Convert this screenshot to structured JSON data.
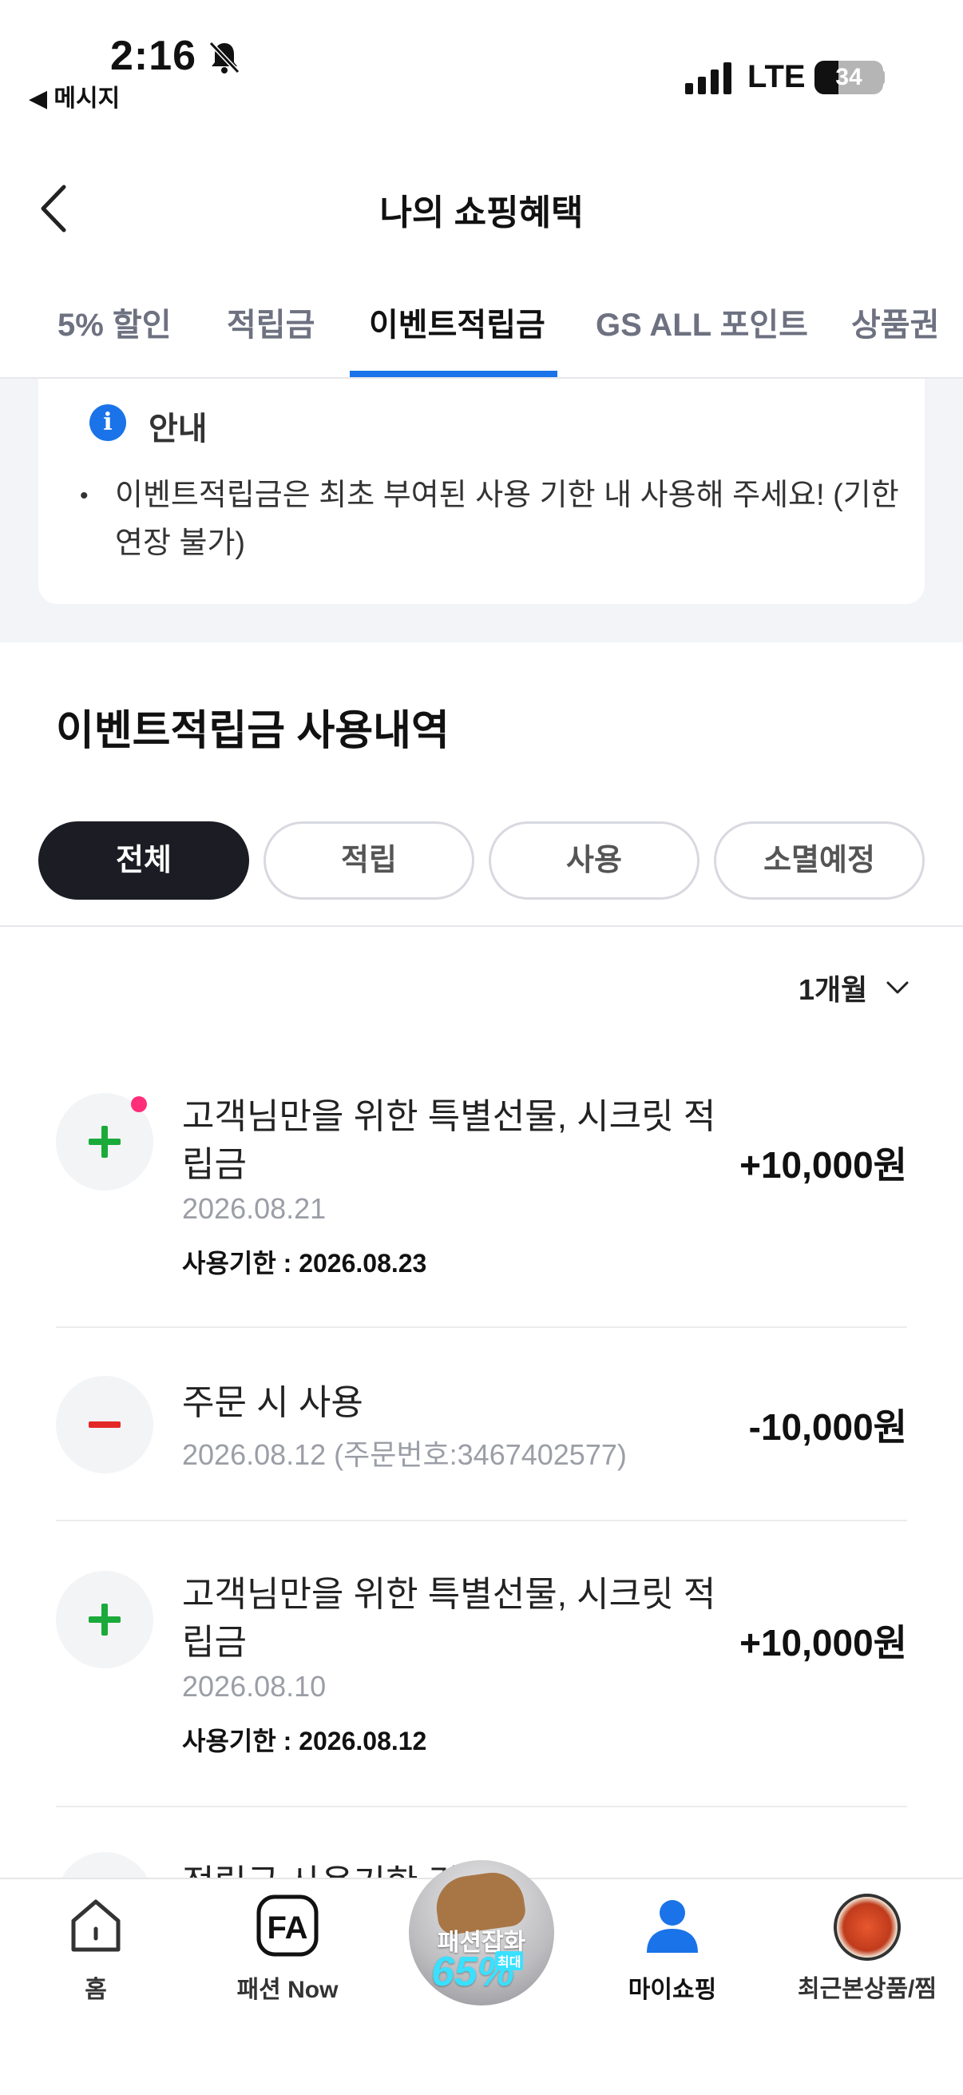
{
  "status_bar": {
    "time": "2:16",
    "back_app": "◀ 메시지",
    "network": "LTE",
    "battery": "34"
  },
  "header": {
    "title": "나의 쇼핑혜택"
  },
  "tabs": [
    {
      "label": "5% 할인"
    },
    {
      "label": "적립금"
    },
    {
      "label": "이벤트적립금"
    },
    {
      "label": "GS ALL 포인트"
    },
    {
      "label": "상품권"
    }
  ],
  "active_tab": "이벤트적립금",
  "info": {
    "title": "안내",
    "icon": "info-icon",
    "bullet": "•",
    "text": "이벤트적립금은 최초 부여된 사용 기한 내 사용해 주세요! (기한연장 불가)"
  },
  "history": {
    "title": "이벤트적립금 사용내역",
    "filters": [
      {
        "label": "전체"
      },
      {
        "label": "적립"
      },
      {
        "label": "사용"
      },
      {
        "label": "소멸예정"
      }
    ],
    "active_filter": "전체",
    "period": "1개월",
    "entries": [
      {
        "type": "earn",
        "title": "고객님만을 위한 특별선물, 시크릿 적립금",
        "date": "2026.08.21",
        "expiry": "사용기한 : 2026.08.23",
        "amount": "+10,000원",
        "new": true
      },
      {
        "type": "use",
        "title": "주문 시 사용",
        "date": "2026.08.12 (주문번호:3467402577)",
        "amount": "-10,000원"
      },
      {
        "type": "earn",
        "title": "고객님만을 위한 특별선물, 시크릿 적립금",
        "date": "2026.08.10",
        "expiry": "사용기한 : 2026.08.12",
        "amount": "+10,000원"
      }
    ],
    "peek_title": "적립금 사용기한 경"
  },
  "bottom_nav": {
    "items": [
      {
        "label": "홈",
        "icon": "home-icon"
      },
      {
        "label": "패션 Now",
        "icon": "fashion-now-icon"
      },
      {
        "label": "마이쇼핑",
        "icon": "person-icon"
      },
      {
        "label": "최근본상품/찜",
        "icon": "recent-product-thumbnail"
      }
    ],
    "promo": {
      "line1": "패션잡화",
      "line2": "65%",
      "badge": "최대"
    }
  },
  "colors": {
    "accent": "#1a73e8",
    "plus": "#1aaa3a",
    "minus": "#e42828",
    "chip_active": "#1b1c24",
    "new_dot": "#ff2d7a"
  }
}
